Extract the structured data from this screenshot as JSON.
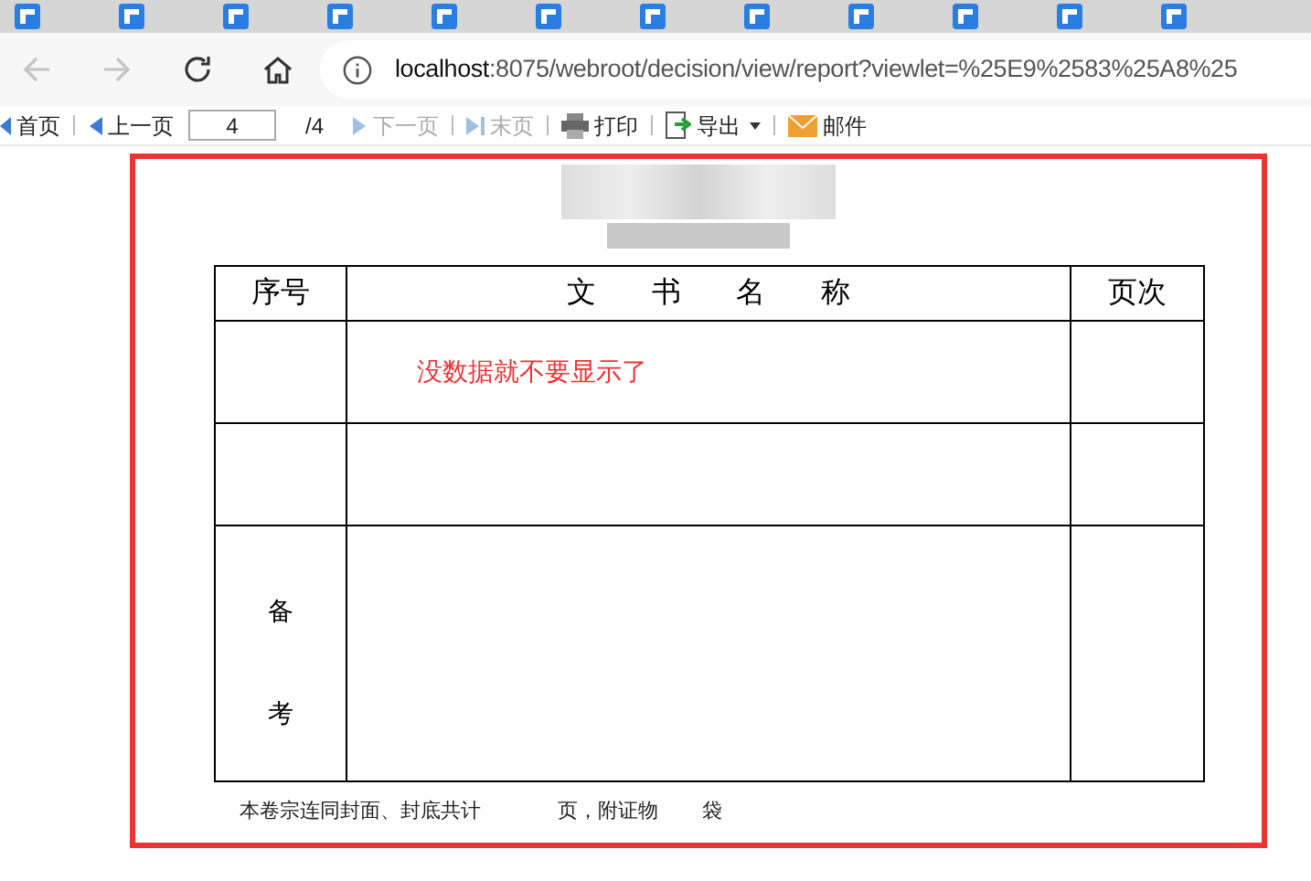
{
  "browser": {
    "url_host": "localhost",
    "url_rest": ":8075/webroot/decision/view/report?viewlet=%25E9%2583%25A8%25"
  },
  "toolbar": [
    {
      "kind": "first",
      "label": "首页",
      "disabled": false
    },
    {
      "kind": "prev",
      "label": "上一页",
      "disabled": false
    },
    {
      "kind": "page_input",
      "value": "4"
    },
    {
      "kind": "total",
      "label": "/4"
    },
    {
      "kind": "next",
      "label": "下一页",
      "disabled": true
    },
    {
      "kind": "last",
      "label": "末页",
      "disabled": true
    },
    {
      "kind": "print",
      "label": "打印",
      "disabled": false
    },
    {
      "kind": "export",
      "label": "导出",
      "disabled": false
    },
    {
      "kind": "mail",
      "label": "邮件",
      "disabled": false
    }
  ],
  "report": {
    "columns": [
      "序号",
      "文书名称",
      "页次"
    ],
    "rows": [
      {
        "note": "没数据就不要显示了"
      },
      {}
    ],
    "remark_label": "备考",
    "footer": [
      "本卷宗连同封面、封底共计",
      "页，附证物",
      "袋"
    ]
  }
}
